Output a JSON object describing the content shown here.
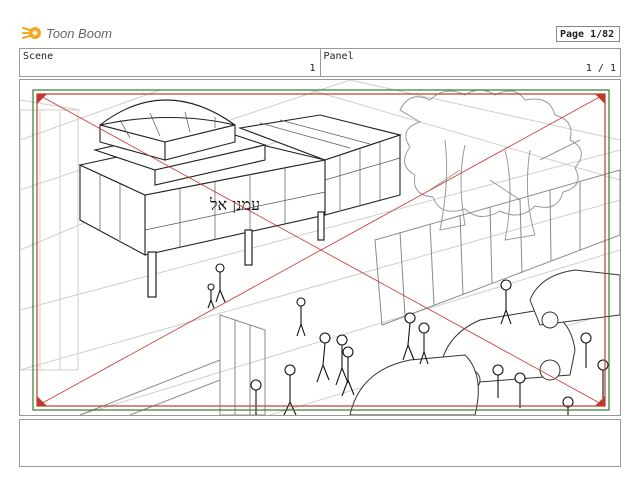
{
  "header": {
    "logo_text": "Toon Boom",
    "page_label": "Page",
    "page_value": " 1/82"
  },
  "info": {
    "scene_label": "Scene",
    "scene_value": "1",
    "panel_label": "Panel",
    "panel_value": "1 / 1"
  },
  "drawing": {
    "sign_text": "עמנן אל"
  },
  "colors": {
    "logo_accent": "#f5a623",
    "safe_frame": "#c0392b",
    "camera_frame": "#2e7d32"
  }
}
